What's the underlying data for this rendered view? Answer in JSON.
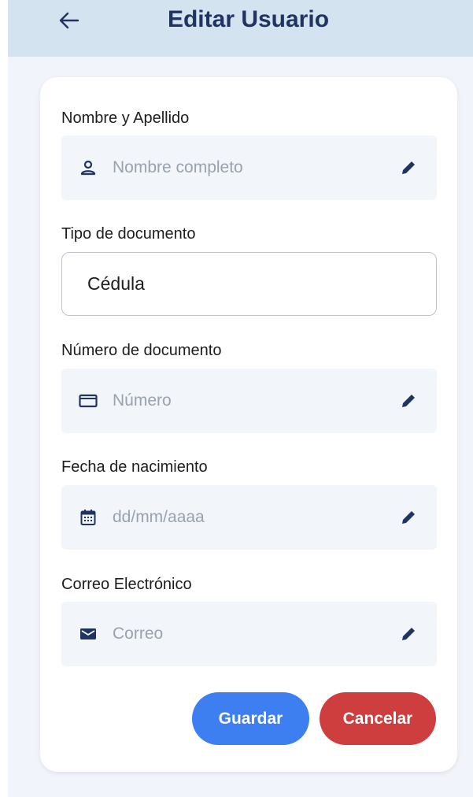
{
  "header": {
    "title": "Editar Usuario"
  },
  "form": {
    "name": {
      "label": "Nombre y Apellido",
      "placeholder": "Nombre completo"
    },
    "doc_type": {
      "label": "Tipo de documento",
      "value": "Cédula"
    },
    "doc_number": {
      "label": "Número de documento",
      "placeholder": "Número"
    },
    "birth_date": {
      "label": "Fecha de nacimiento",
      "placeholder": "dd/mm/aaaa"
    },
    "email": {
      "label": "Correo Electrónico",
      "placeholder": "Correo"
    }
  },
  "actions": {
    "save_label": "Guardar",
    "cancel_label": "Cancelar"
  },
  "icons": {
    "back": "arrow-left-icon",
    "name": "person-icon",
    "doc_number": "card-icon",
    "birth_date": "calendar-icon",
    "email": "mail-icon",
    "edit": "pencil-icon"
  },
  "colors": {
    "appbar": "#d4e3f0",
    "title": "#1f3461",
    "icon": "#1f3461",
    "primary": "#3d7ef0",
    "danger": "#cf3e3e"
  }
}
